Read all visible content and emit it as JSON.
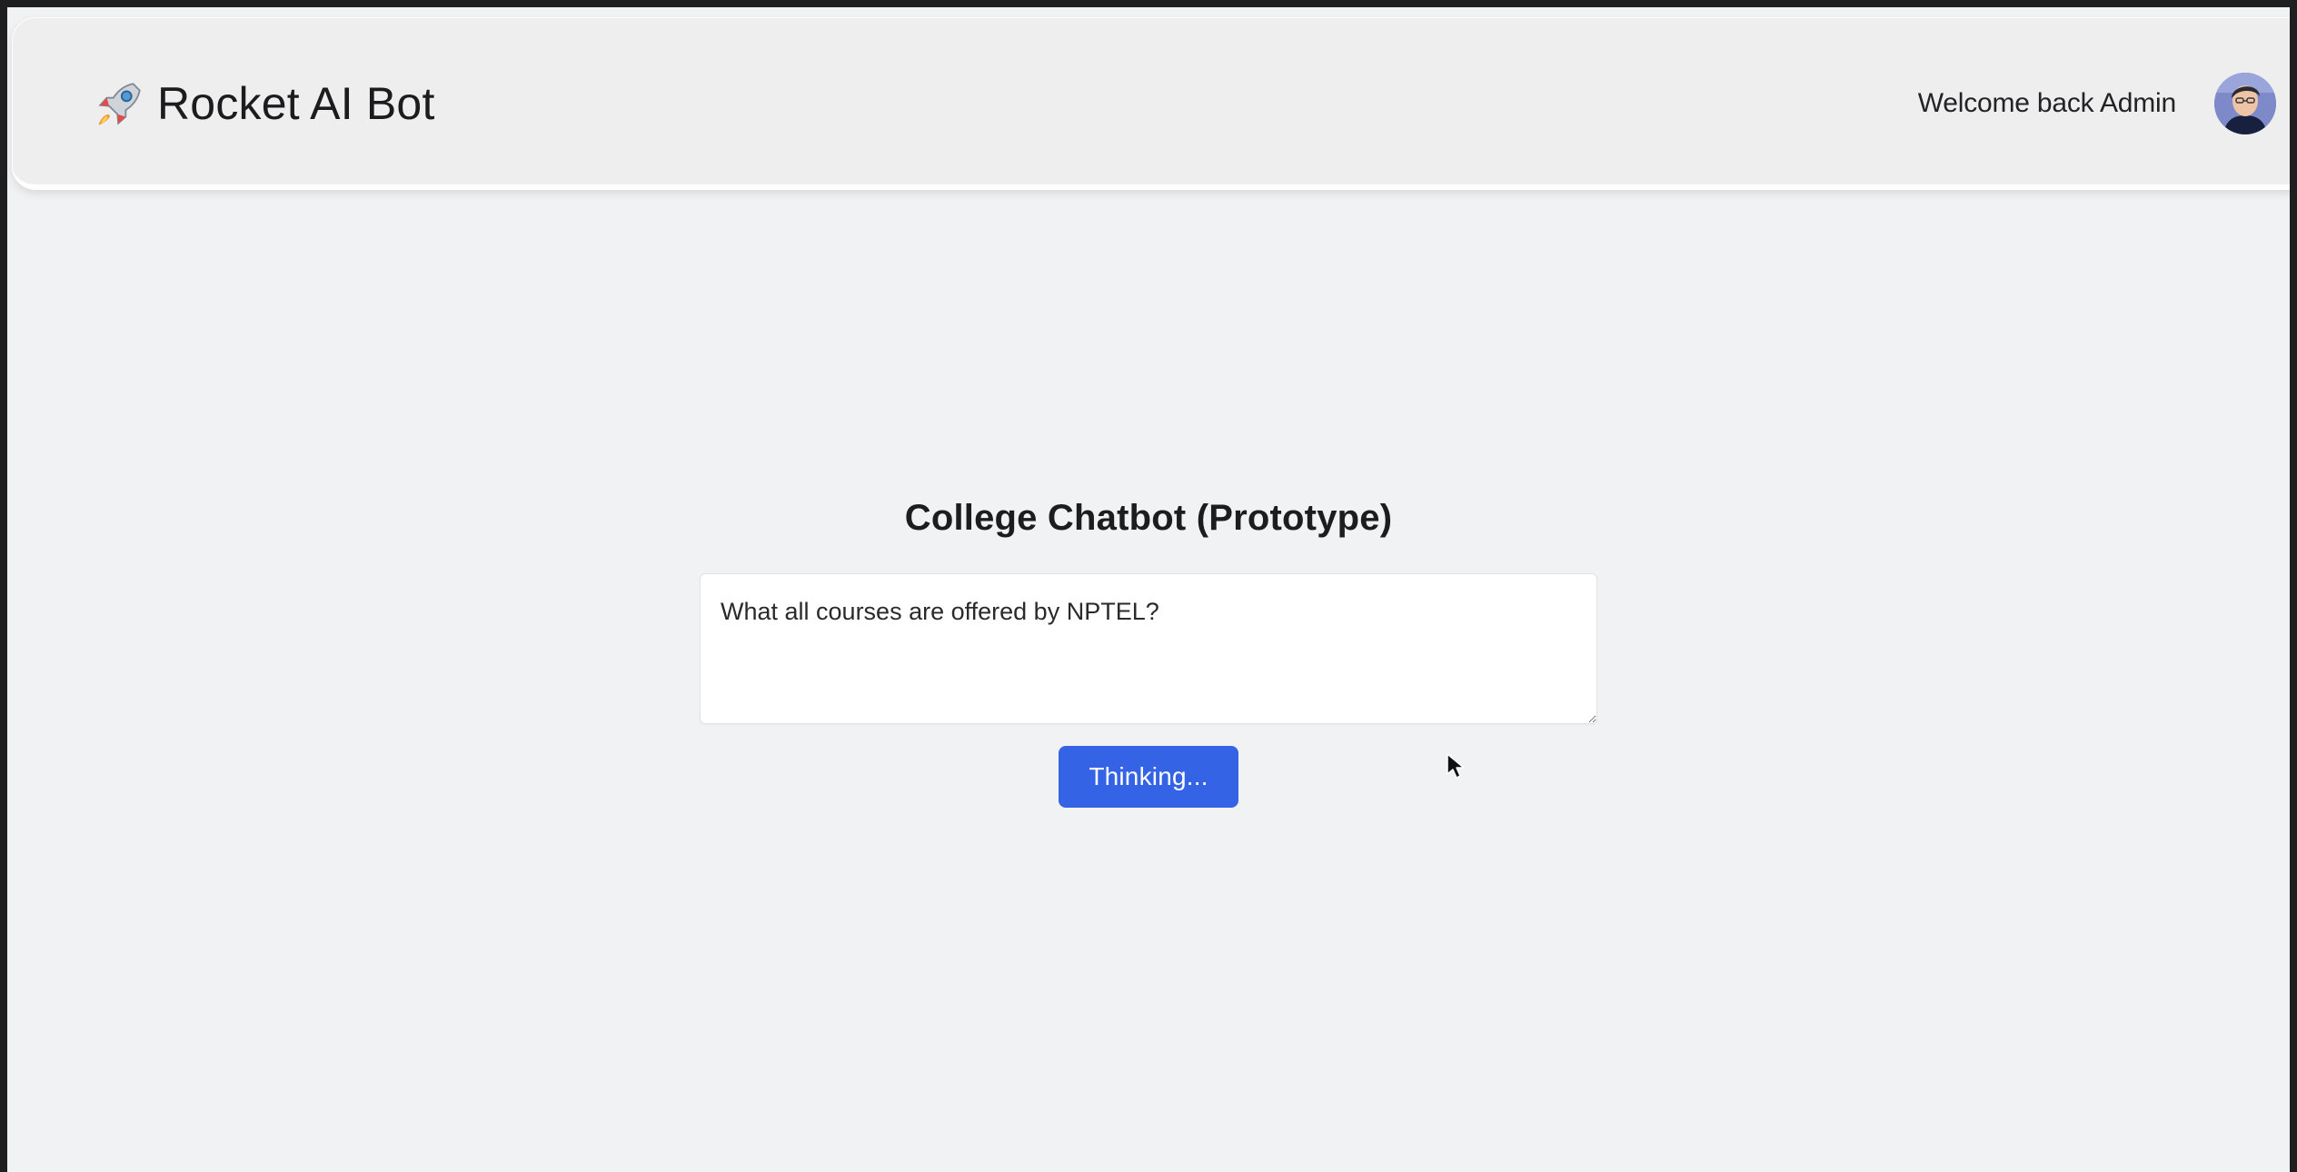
{
  "navbar": {
    "app_title": "Rocket AI Bot",
    "brand_icon": "rocket-icon",
    "welcome_text": "Welcome back Admin",
    "avatar_icon": "user-avatar"
  },
  "main": {
    "title": "College Chatbot (Prototype)",
    "query_value": "What all courses are offered by NPTEL?",
    "submit_label": "Thinking..."
  },
  "colors": {
    "page_background": "#f1f2f4",
    "navbar_background": "#eeeeef",
    "button": "#3563e6"
  }
}
